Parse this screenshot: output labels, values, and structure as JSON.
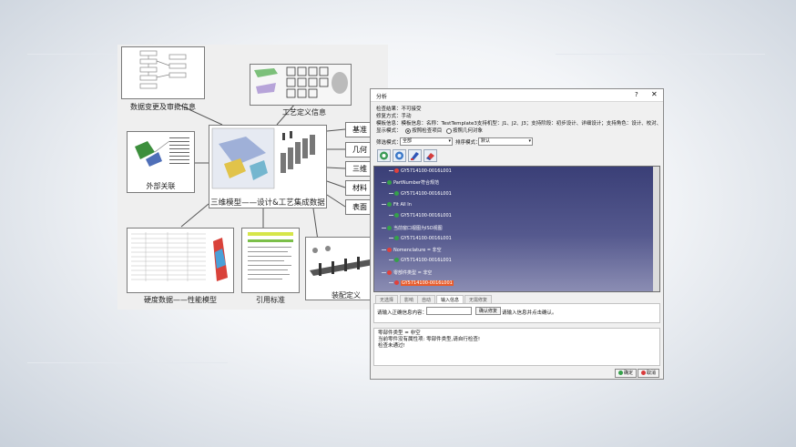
{
  "diagram": {
    "center_caption": "三维模型——设计&工艺集成数据",
    "nodes": {
      "change_info": "数据变更及审批信息",
      "process_info": "工艺定义信息",
      "external": "外部关联",
      "hardness": "硬度数据——性能模型",
      "standard": "引用标准",
      "assembly": "装配定义"
    },
    "side_boxes": [
      "基准",
      "几何",
      "三维",
      "材料",
      "表面"
    ]
  },
  "window": {
    "title": "分析",
    "help": "?",
    "close": "✕",
    "info_lines": [
      "检查结果：不可接受",
      "修复方式：手动",
      "模板信息：模板信息：名称：TestTemplate3支持机型：J1、J2、J3；支持阶段：初步设计、详细设计；支持角色：设计、校对、审核。"
    ],
    "display_label": "显示模式：",
    "radio_options": [
      {
        "label": "按照检查项目",
        "selected": true
      },
      {
        "label": "按照几何对象",
        "selected": false
      }
    ],
    "filter_label": "筛选模式：",
    "filter_value": "全部",
    "sort_label": "排序模式：",
    "sort_value": "默认",
    "toolbar_icons": [
      "filter-icon",
      "refresh-icon",
      "brush-icon",
      "eraser-icon"
    ],
    "tree_rows": [
      {
        "text": "GY5714100-0016L001",
        "indent": 3,
        "dot": "#e0413c",
        "selected": false
      },
      {
        "text": "PartNumber符合规范",
        "indent": 1,
        "dot": "#35a04a",
        "selected": false
      },
      {
        "text": "GY5714100-0016L001",
        "indent": 3,
        "dot": "#35a04a",
        "selected": false
      },
      {
        "text": "Fit All In",
        "indent": 1,
        "dot": "#35a04a",
        "selected": false
      },
      {
        "text": "GY5714100-0016L001",
        "indent": 3,
        "dot": "#35a04a",
        "selected": false
      },
      {
        "text": "当前窗口视图为ISO视图",
        "indent": 1,
        "dot": "#35a04a",
        "selected": false
      },
      {
        "text": "GY5714100-0016L001",
        "indent": 3,
        "dot": "#35a04a",
        "selected": false
      },
      {
        "text": "Nomenclature = 非空",
        "indent": 1,
        "dot": "#e0413c",
        "selected": false
      },
      {
        "text": "GY5714100-0016L001",
        "indent": 3,
        "dot": "#35a04a",
        "selected": false
      },
      {
        "text": "零部件类型 = 非空",
        "indent": 1,
        "dot": "#e0413c",
        "selected": false
      },
      {
        "text": "GY5714100-0016L001",
        "indent": 3,
        "dot": "#e0413c",
        "selected": true
      }
    ],
    "tabs": [
      {
        "label": "无选择",
        "active": false
      },
      {
        "label": "影响",
        "active": false
      },
      {
        "label": "自动",
        "active": false
      },
      {
        "label": "输入信息",
        "active": true
      },
      {
        "label": "无需修复",
        "active": false
      }
    ],
    "input_label": "请输入正确信息内容：",
    "input_value": "",
    "confirm_fix_button": "确认修复",
    "input_hint": "请输入信息并点击确认。",
    "message_lines": [
      "零部件类型 = 非空",
      "当前零件没有属性项: 零部件类型,请自行检查!",
      "检查未通过!"
    ],
    "ok_button": "确定",
    "cancel_button": "取消"
  }
}
